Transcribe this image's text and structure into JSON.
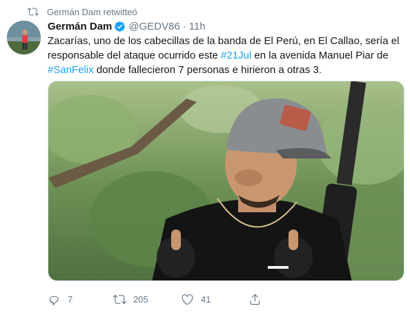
{
  "retweet_banner": {
    "text": "Germán Dam retwitteó",
    "icon": "retweet-icon"
  },
  "author": {
    "name": "Germán Dam",
    "handle": "@GEDV86",
    "separator": "·",
    "time": "11h",
    "verified": true
  },
  "tweet": {
    "segments": [
      {
        "type": "text",
        "value": "Zacarías, uno de los cabecillas de la banda de El Perú, en El Callao, sería el responsable del ataque ocurrido este "
      },
      {
        "type": "hashtag",
        "value": "#21Jul"
      },
      {
        "type": "text",
        "value": " en la avenida Manuel Piar de "
      },
      {
        "type": "hashtag",
        "value": "#SanFelix"
      },
      {
        "type": "text",
        "value": " donde fallecieron 7 personas e hirieron a otras 3."
      }
    ]
  },
  "actions": {
    "reply": {
      "icon": "reply-icon",
      "count": "7"
    },
    "retweet": {
      "icon": "retweet-icon",
      "count": "205"
    },
    "like": {
      "icon": "heart-icon",
      "count": "41"
    },
    "share": {
      "icon": "share-icon"
    }
  },
  "colors": {
    "link": "#1da1f2",
    "secondary": "#657786",
    "text": "#14171a",
    "verified": "#1da1f2"
  }
}
